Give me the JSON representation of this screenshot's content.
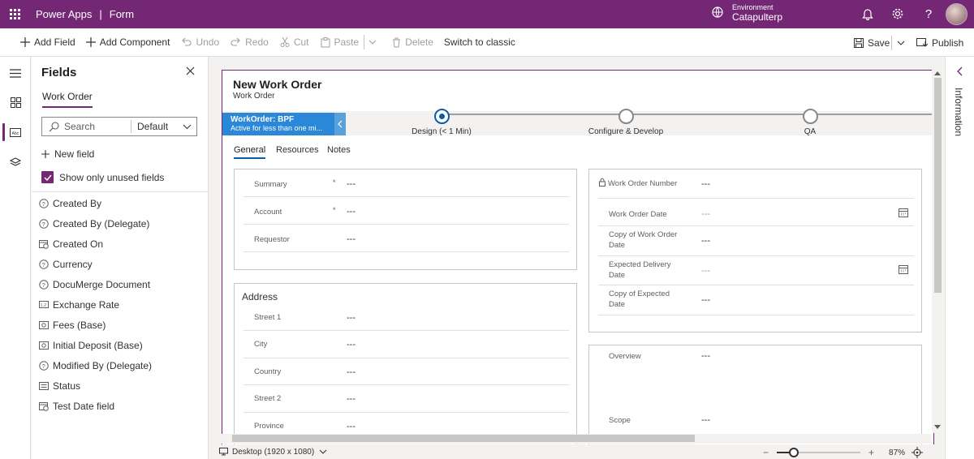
{
  "topbar": {
    "app_name": "Power Apps",
    "separator": "|",
    "form_name": "Form",
    "environment_label": "Environment",
    "environment_value": "Catapulterp",
    "icons": [
      "waffle-icon",
      "environment-icon",
      "bell-icon",
      "gear-icon",
      "help-icon"
    ]
  },
  "commandbar": {
    "add_field": "Add Field",
    "add_component": "Add Component",
    "undo": "Undo",
    "redo": "Redo",
    "cut": "Cut",
    "paste": "Paste",
    "delete": "Delete",
    "switch_classic": "Switch to classic",
    "save": "Save",
    "publish": "Publish"
  },
  "fields_panel": {
    "title": "Fields",
    "tab": "Work Order",
    "search_placeholder": "Search",
    "filter_value": "Default",
    "new_field": "New field",
    "show_unused": "Show only unused fields",
    "show_unused_checked": true,
    "items": [
      {
        "label": "Created By",
        "icon": "lookup-icon"
      },
      {
        "label": "Created By (Delegate)",
        "icon": "lookup-icon"
      },
      {
        "label": "Created On",
        "icon": "calendar-icon"
      },
      {
        "label": "Currency",
        "icon": "lookup-icon"
      },
      {
        "label": "DocuMerge Document",
        "icon": "lookup-icon"
      },
      {
        "label": "Exchange Rate",
        "icon": "decimal-icon"
      },
      {
        "label": "Fees (Base)",
        "icon": "currency-icon"
      },
      {
        "label": "Initial Deposit (Base)",
        "icon": "currency-icon"
      },
      {
        "label": "Modified By (Delegate)",
        "icon": "lookup-icon"
      },
      {
        "label": "Status",
        "icon": "optionset-icon"
      },
      {
        "label": "Test Date field",
        "icon": "calendar-icon"
      }
    ]
  },
  "form": {
    "title": "New Work Order",
    "subtitle": "Work Order",
    "bpf": {
      "flag_title": "WorkOrder: BPF",
      "flag_subtitle": "Active for less than one mi...",
      "stages": [
        {
          "label": "Design  (< 1 Min)",
          "active": true
        },
        {
          "label": "Configure & Develop",
          "active": false
        },
        {
          "label": "QA",
          "active": false
        }
      ]
    },
    "tabs": [
      "General",
      "Resources",
      "Notes"
    ],
    "left_section": {
      "rows": [
        {
          "label": "Summary",
          "required": "*",
          "value": "---"
        },
        {
          "label": "Account",
          "required": "*",
          "value": "---"
        },
        {
          "label": "Requestor",
          "required": "",
          "value": "---"
        }
      ]
    },
    "address_section": {
      "title": "Address",
      "rows": [
        {
          "label": "Street 1",
          "value": "---"
        },
        {
          "label": "City",
          "value": "---"
        },
        {
          "label": "Country",
          "value": "---"
        },
        {
          "label": "Street 2",
          "value": "---"
        },
        {
          "label": "Province",
          "value": "---"
        }
      ]
    },
    "right_section": {
      "rows": [
        {
          "label": "Work Order Number",
          "value": "---",
          "locked": true
        },
        {
          "label": "Work Order Date",
          "value": "---",
          "date": true
        },
        {
          "label": "Copy of Work Order Date",
          "value": "---"
        },
        {
          "label": "Expected Delivery Date",
          "value": "---",
          "date": true
        },
        {
          "label": "Copy of Expected Date",
          "value": "---"
        }
      ]
    },
    "overview_section": {
      "rows": [
        {
          "label": "Overview",
          "value": "---"
        },
        {
          "label": "Scope",
          "value": "---"
        }
      ]
    }
  },
  "info_pane": {
    "label": "Information"
  },
  "statusbar": {
    "device": "Desktop (1920 x 1080)",
    "zoom_minus": "−",
    "zoom_plus": "+",
    "zoom_value": "87%",
    "zoom_level": 0.2
  }
}
